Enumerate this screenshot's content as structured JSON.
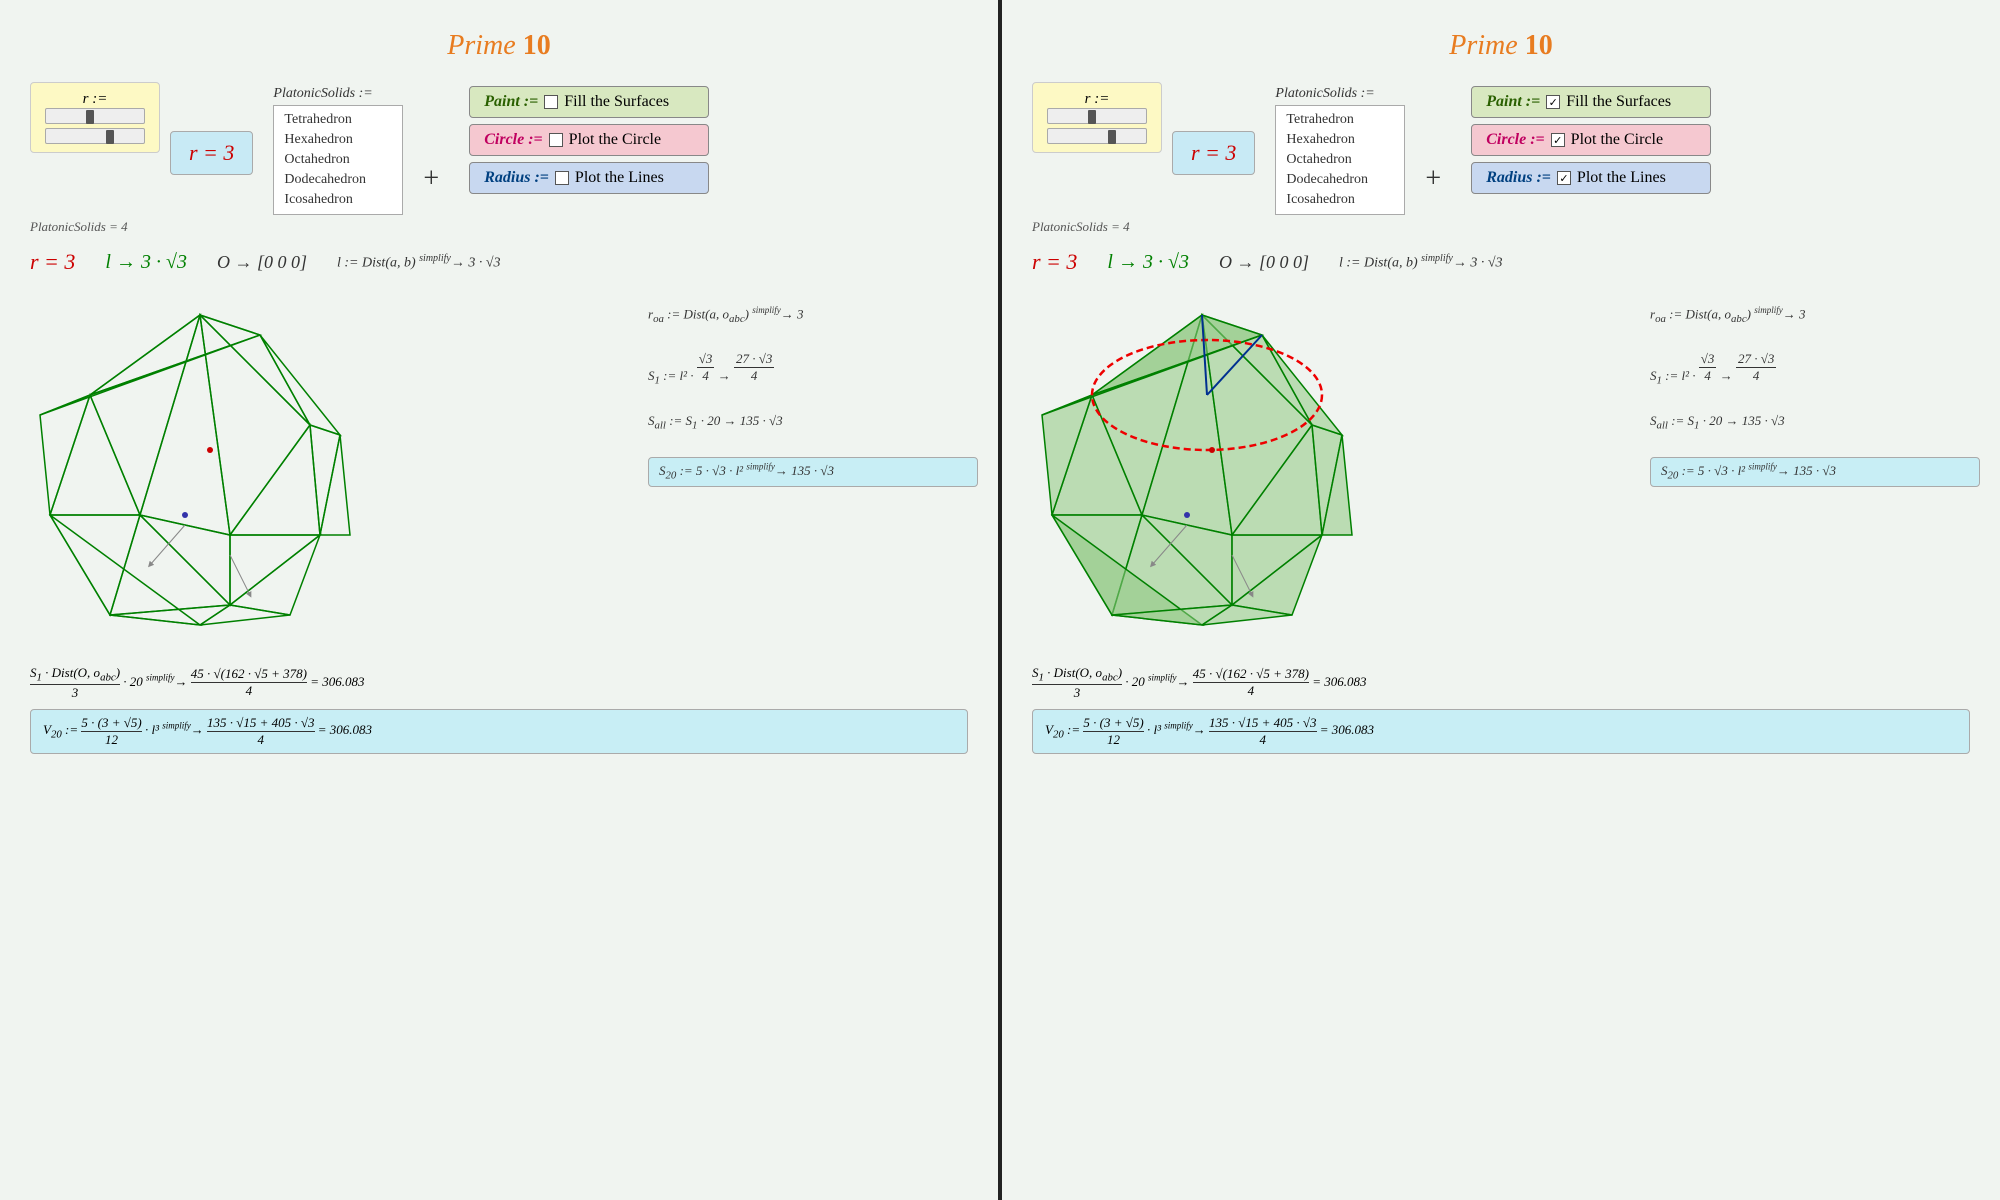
{
  "left": {
    "title": "Prime ",
    "title_bold": "10",
    "r_label": "r :=",
    "r_value": "r = 3",
    "platonic_label": "PlatonicSolids :=",
    "platonic_eq": "PlatonicSolids = 4",
    "dropdown_items": [
      "Tetrahedron",
      "Hexahedron",
      "Octahedron",
      "Dodecahedron",
      "Icosahedron"
    ],
    "paint_label": "Paint := ",
    "paint_text": "Fill the Surfaces",
    "circle_label": "Circle := ",
    "circle_text": "Plot the Circle",
    "radius_label": "Radius := ",
    "radius_text": "Plot the Lines",
    "paint_checked": false,
    "circle_checked": false,
    "radius_checked": false,
    "math_r": "r = 3",
    "math_l": "l → 3 · √3",
    "math_o": "O → [0  0  0]",
    "math_dist": "l := Dist(a, b) → 3 · √3",
    "formula1": "r_oa := Dist(a, o_abc) → 3",
    "formula2": "S₁ := l² · (√3/4) → 27·√3/4",
    "formula3": "S_all := S₁ · 20 → 135 · √3",
    "formula4": "S₂₀ := 5·√3·l² → 135·√3",
    "bottom1": "S₁·Dist(O, o_abc)/3 · 20 → 45·√(162·√5+378)/4 = 306.083",
    "bottom2": "V₂₀ := 5·(3+√5)/12 · l³ → 135·√15+405·√3/4 = 306.083"
  },
  "right": {
    "title": "Prime ",
    "title_bold": "10",
    "r_label": "r :=",
    "r_value": "r = 3",
    "platonic_label": "PlatonicSolids :=",
    "platonic_eq": "PlatonicSolids = 4",
    "dropdown_items": [
      "Tetrahedron",
      "Hexahedron",
      "Octahedron",
      "Dodecahedron",
      "Icosahedron"
    ],
    "paint_label": "Paint := ",
    "paint_text": "Fill the Surfaces",
    "circle_label": "Circle := ",
    "circle_text": "Plot the Circle",
    "radius_label": "Radius := ",
    "radius_text": "Plot the Lines",
    "paint_checked": true,
    "circle_checked": true,
    "radius_checked": true,
    "math_r": "r = 3",
    "math_l": "l → 3 · √3",
    "math_o": "O → [0  0  0]",
    "math_dist": "l := Dist(a, b) → 3 · √3",
    "formula1": "r_oa := Dist(a, o_abc) → 3",
    "formula2": "S₁ := l² · (√3/4) → 27·√3/4",
    "formula3": "S_all := S₁ · 20 → 135 · √3",
    "formula4": "S₂₀ := 5·√3·l² → 135·√3",
    "bottom1": "S₁·Dist(O, o_abc)/3 · 20 → 45·√(162·√5+378)/4 = 306.083",
    "bottom2": "V₂₀ := 5·(3+√5)/12 · l³ → 135·√15+405·√3/4 = 306.083"
  }
}
